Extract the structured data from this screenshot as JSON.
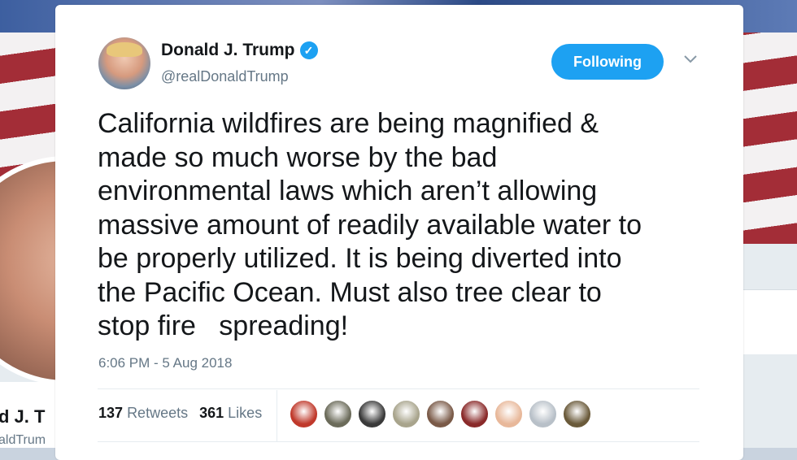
{
  "background": {
    "name_partial": "d J. T",
    "handle_partial": "aldTrum"
  },
  "tweet": {
    "author_name": "Donald J. Trump",
    "author_handle": "@realDonaldTrump",
    "verified_icon": "verified-badge-icon",
    "follow_button": "Following",
    "text": "California wildfires are being magnified &\nmade so much worse by the bad\nenvironmental laws which aren’t allowing\nmassive amount of readily available water to\nbe properly utilized. It is being diverted into\nthe Pacific Ocean. Must also tree clear to\nstop fire   spreading!",
    "timestamp": "6:06 PM - 5 Aug 2018",
    "retweets_count": "137",
    "retweets_label": "Retweets",
    "likes_count": "361",
    "likes_label": "Likes"
  },
  "colors": {
    "accent": "#1da1f2",
    "text": "#14171a",
    "muted": "#657786"
  },
  "likers": [
    {
      "color": "#c0392b"
    },
    {
      "color": "#6b6b5a"
    },
    {
      "color": "#3a3a3a"
    },
    {
      "color": "#a8a48c"
    },
    {
      "color": "#7a5a48"
    },
    {
      "color": "#8a2a2a"
    },
    {
      "color": "#e8b89a"
    },
    {
      "color": "#b8c0c8"
    },
    {
      "color": "#6a5a3a"
    }
  ]
}
